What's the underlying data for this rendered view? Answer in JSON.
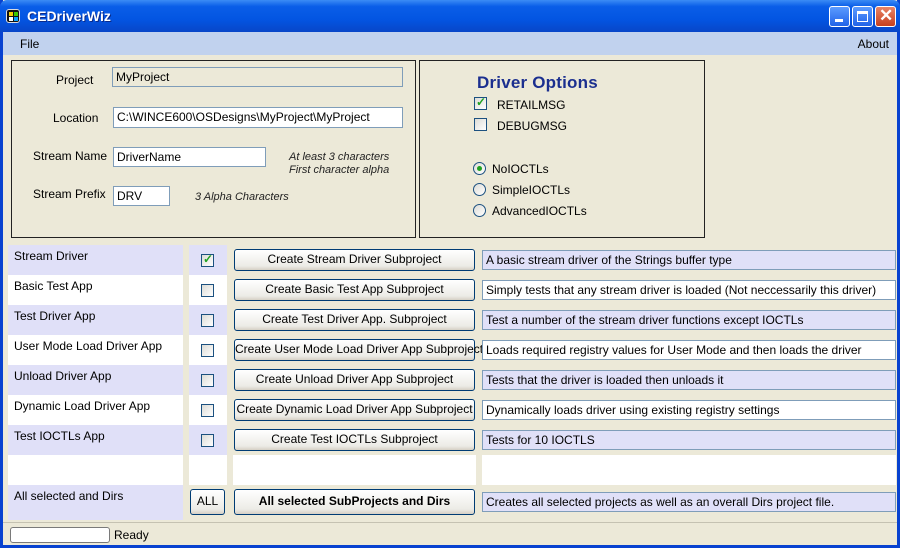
{
  "window": {
    "title": "CEDriverWiz"
  },
  "menu": {
    "file": "File",
    "about": "About"
  },
  "project_panel": {
    "project_label": "Project",
    "project_value": "MyProject",
    "location_label": "Location",
    "location_value": "C:\\WINCE600\\OSDesigns\\MyProject\\MyProject",
    "stream_name_label": "Stream Name",
    "stream_name_value": "DriverName",
    "stream_name_hint_1": "At least 3 characters",
    "stream_name_hint_2": "First character alpha",
    "stream_prefix_label": "Stream Prefix",
    "stream_prefix_value": "DRV",
    "stream_prefix_hint": "3 Alpha Characters"
  },
  "driver_options": {
    "title": "Driver Options",
    "checkboxes": [
      {
        "label": "RETAILMSG",
        "checked": true
      },
      {
        "label": "DEBUGMSG",
        "checked": false
      }
    ],
    "radios": [
      {
        "label": "NoIOCTLs",
        "selected": true
      },
      {
        "label": "SimpleIOCTLs",
        "selected": false
      },
      {
        "label": "AdvancedIOCTLs",
        "selected": false
      }
    ]
  },
  "subprojects": [
    {
      "name": "Stream Driver",
      "checked": true,
      "button": "Create Stream Driver Subproject",
      "description": "A basic stream driver of the Strings buffer type"
    },
    {
      "name": "Basic Test App",
      "checked": false,
      "button": "Create Basic Test App Subproject",
      "description": "Simply tests that any stream driver is loaded (Not neccessarily this driver)"
    },
    {
      "name": "Test Driver App",
      "checked": false,
      "button": "Create Test Driver App. Subproject",
      "description": "Test a number of the stream driver functions except IOCTLs"
    },
    {
      "name": "User Mode Load Driver App",
      "checked": false,
      "button": "Create  User Mode Load Driver App Subproject",
      "description": "Loads required registry values for User Mode and then loads the driver"
    },
    {
      "name": "Unload Driver App",
      "checked": false,
      "button": "Create Unload Driver App Subproject",
      "description": "Tests that the driver is loaded then unloads it"
    },
    {
      "name": "Dynamic Load Driver App",
      "checked": false,
      "button": "Create Dynamic Load Driver App Subproject",
      "description": "Dynamically loads driver using existing registry settings"
    },
    {
      "name": "Test IOCTLs App",
      "checked": false,
      "button": "Create Test IOCTLs Subproject",
      "description": "Tests for 10  IOCTLS"
    }
  ],
  "all_row": {
    "name": "All selected and Dirs",
    "all_button": "ALL",
    "button": "All selected SubProjects and Dirs",
    "description": "Creates all selected projects as well as an overall Dirs project file."
  },
  "status": {
    "text": "Ready"
  }
}
